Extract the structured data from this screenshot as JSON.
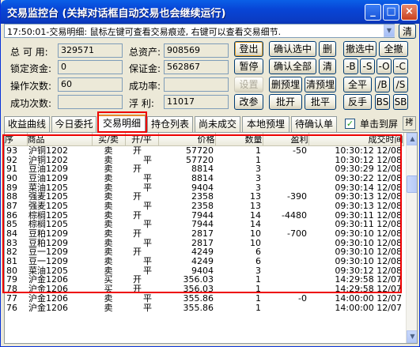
{
  "window": {
    "title": "交易监控台 (关掉对话框自动交易也会继续运行)",
    "min": "_",
    "max": "□",
    "close": "×"
  },
  "ticker": {
    "text": "17:50:01-交易明细: 鼠标左键可查看交易痕迹, 右键可以查看交易细节.",
    "clear": "清"
  },
  "account": {
    "total_label": "总 可 用:",
    "total_value": "329571",
    "locked_label": "锁定资金:",
    "locked_value": "0",
    "ops_label": "操作次数:",
    "ops_value": "60",
    "success_label": "成功次数:",
    "success_value": "",
    "assets_label": "总资产:",
    "assets_value": "908569",
    "margin_label": "保证金:",
    "margin_value": "562867",
    "rate_label": "成功率:",
    "rate_value": "",
    "float_label": "浮  利:",
    "float_value": "11017"
  },
  "buttons": {
    "login": "登出",
    "pause": "暂停",
    "settings": "设置",
    "modify": "改参",
    "confirm_selected": "确认选中",
    "confirm_all": "确认全部",
    "batch_preorder": "删预埋",
    "batch_open": "批开",
    "delete": "删",
    "clear": "清",
    "clear_preorder": "清预埋",
    "batch_close": "批平",
    "cancel_selected": "撤选中",
    "cancel_all": "全撤",
    "minus_b": "-B",
    "minus_s": "-S",
    "minus_o": "-O",
    "minus_c": "-C",
    "flat_all": "全平",
    "slash_b": "/B",
    "slash_s": "/S",
    "reverse": "反手",
    "bs": "BS",
    "sb": "SB"
  },
  "tabs": [
    "收益曲线",
    "今日委托",
    "交易明细",
    "持仓列表",
    "尚未成交",
    "本地预埋",
    "待确认单"
  ],
  "single_click_top": "单击到屏",
  "single_click_checked": "✓",
  "grid": {
    "headers": [
      "序",
      "商品",
      "买/卖",
      "开/平",
      "价格",
      "数量",
      "盈利",
      "成交时间"
    ],
    "rows": [
      [
        "93",
        "沪铜1202",
        "卖",
        "开",
        "57720",
        "1",
        "-50",
        "10:30:12 12/08"
      ],
      [
        "92",
        "沪铜1202",
        "卖",
        "平",
        "57720",
        "1",
        "",
        "10:30:12 12/08"
      ],
      [
        "91",
        "豆油1209",
        "卖",
        "开",
        "8814",
        "3",
        "",
        "09:30:29 12/08"
      ],
      [
        "90",
        "豆油1209",
        "卖",
        "平",
        "8814",
        "3",
        "",
        "09:30:22 12/08"
      ],
      [
        "89",
        "菜油1205",
        "卖",
        "平",
        "9404",
        "3",
        "",
        "09:30:14 12/08"
      ],
      [
        "88",
        "强麦1205",
        "卖",
        "开",
        "2358",
        "13",
        "-390",
        "09:30:13 12/08"
      ],
      [
        "87",
        "强麦1205",
        "卖",
        "平",
        "2358",
        "13",
        "",
        "09:30:13 12/08"
      ],
      [
        "86",
        "棕榈1205",
        "卖",
        "开",
        "7944",
        "14",
        "-4480",
        "09:30:11 12/08"
      ],
      [
        "85",
        "棕榈1205",
        "卖",
        "平",
        "7944",
        "14",
        "",
        "09:30:11 12/08"
      ],
      [
        "84",
        "豆粕1209",
        "卖",
        "开",
        "2817",
        "10",
        "-700",
        "09:30:10 12/08"
      ],
      [
        "83",
        "豆粕1209",
        "卖",
        "平",
        "2817",
        "10",
        "",
        "09:30:10 12/08"
      ],
      [
        "82",
        "豆一1209",
        "卖",
        "开",
        "4249",
        "6",
        "",
        "09:30:10 12/08"
      ],
      [
        "81",
        "豆一1209",
        "卖",
        "平",
        "4249",
        "6",
        "",
        "09:30:10 12/08"
      ],
      [
        "80",
        "菜油1205",
        "卖",
        "平",
        "9404",
        "3",
        "",
        "09:30:12 12/08"
      ],
      [
        "79",
        "沪金1206",
        "买",
        "开",
        "356.03",
        "1",
        "",
        "14:29:58 12/07"
      ],
      [
        "78",
        "沪金1206",
        "买",
        "开",
        "356.03",
        "1",
        "",
        "14:29:58 12/07"
      ],
      [
        "77",
        "沪金1206",
        "卖",
        "平",
        "355.86",
        "1",
        "-0",
        "14:00:00 12/07"
      ],
      [
        "76",
        "沪金1206",
        "卖",
        "平",
        "355.86",
        "1",
        "",
        "14:00:00 12/07"
      ]
    ]
  },
  "scroll": {
    "up": "▲",
    "down": "▼"
  }
}
